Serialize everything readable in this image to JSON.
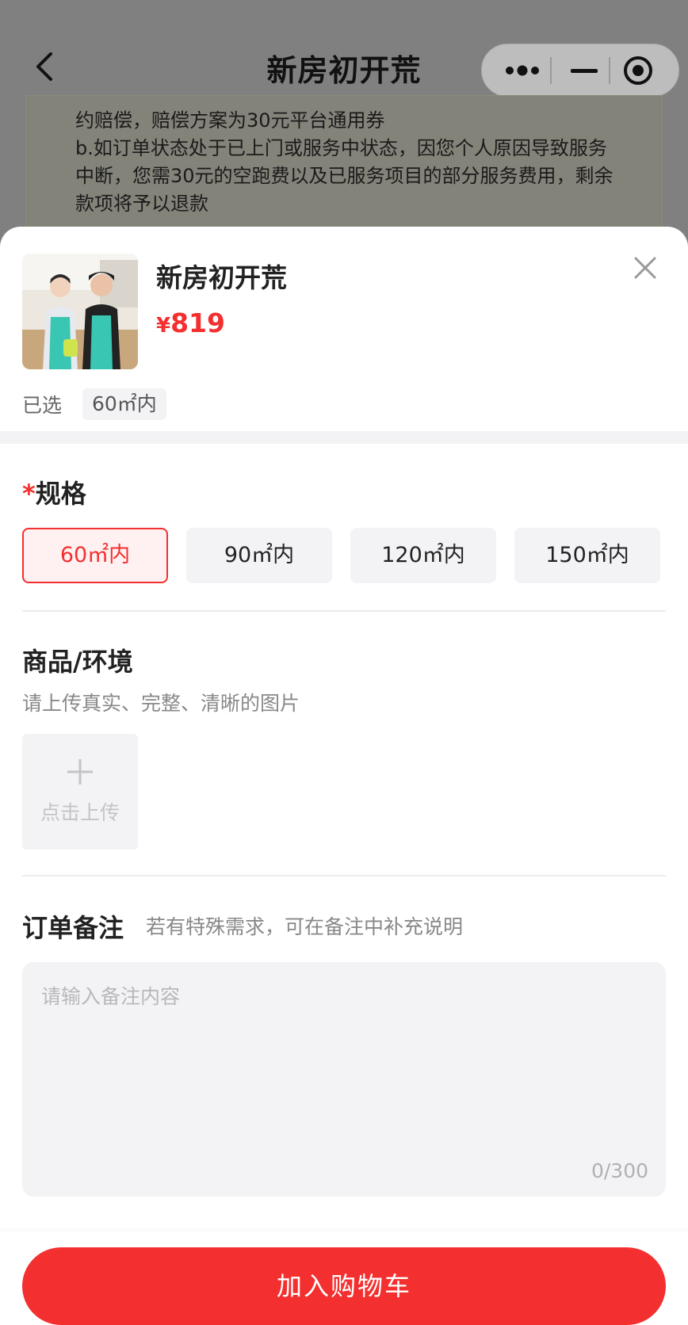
{
  "nav": {
    "title": "新房初开荒"
  },
  "notice": {
    "lines": [
      "约赔偿，赔偿方案为30元平台通用券",
      "b.如订单状态处于已上门或服务中状态，因您个人原因导致服务",
      "中断，您需30元的空跑费以及已服务项目的部分服务费用，剩余",
      "款项将予以退款"
    ]
  },
  "product": {
    "title": "新房初开荒",
    "currency": "¥",
    "price": "819",
    "selected_label": "已选",
    "selected_value": "60㎡内"
  },
  "spec": {
    "required_mark": "*",
    "title": "规格",
    "options": [
      "60㎡内",
      "90㎡内",
      "120㎡内",
      "150㎡内"
    ],
    "active_index": 0
  },
  "environment": {
    "title": "商品/环境",
    "hint": "请上传真实、完整、清晰的图片",
    "upload_label": "点击上传"
  },
  "remark": {
    "title": "订单备注",
    "hint": "若有特殊需求，可在备注中补充说明",
    "placeholder": "请输入备注内容",
    "value": "",
    "count": "0/300"
  },
  "footer": {
    "cart_button": "加入购物车"
  },
  "colors": {
    "accent": "#f42f2f",
    "chip_bg": "#f3f3f5",
    "overlay": "#808080"
  }
}
